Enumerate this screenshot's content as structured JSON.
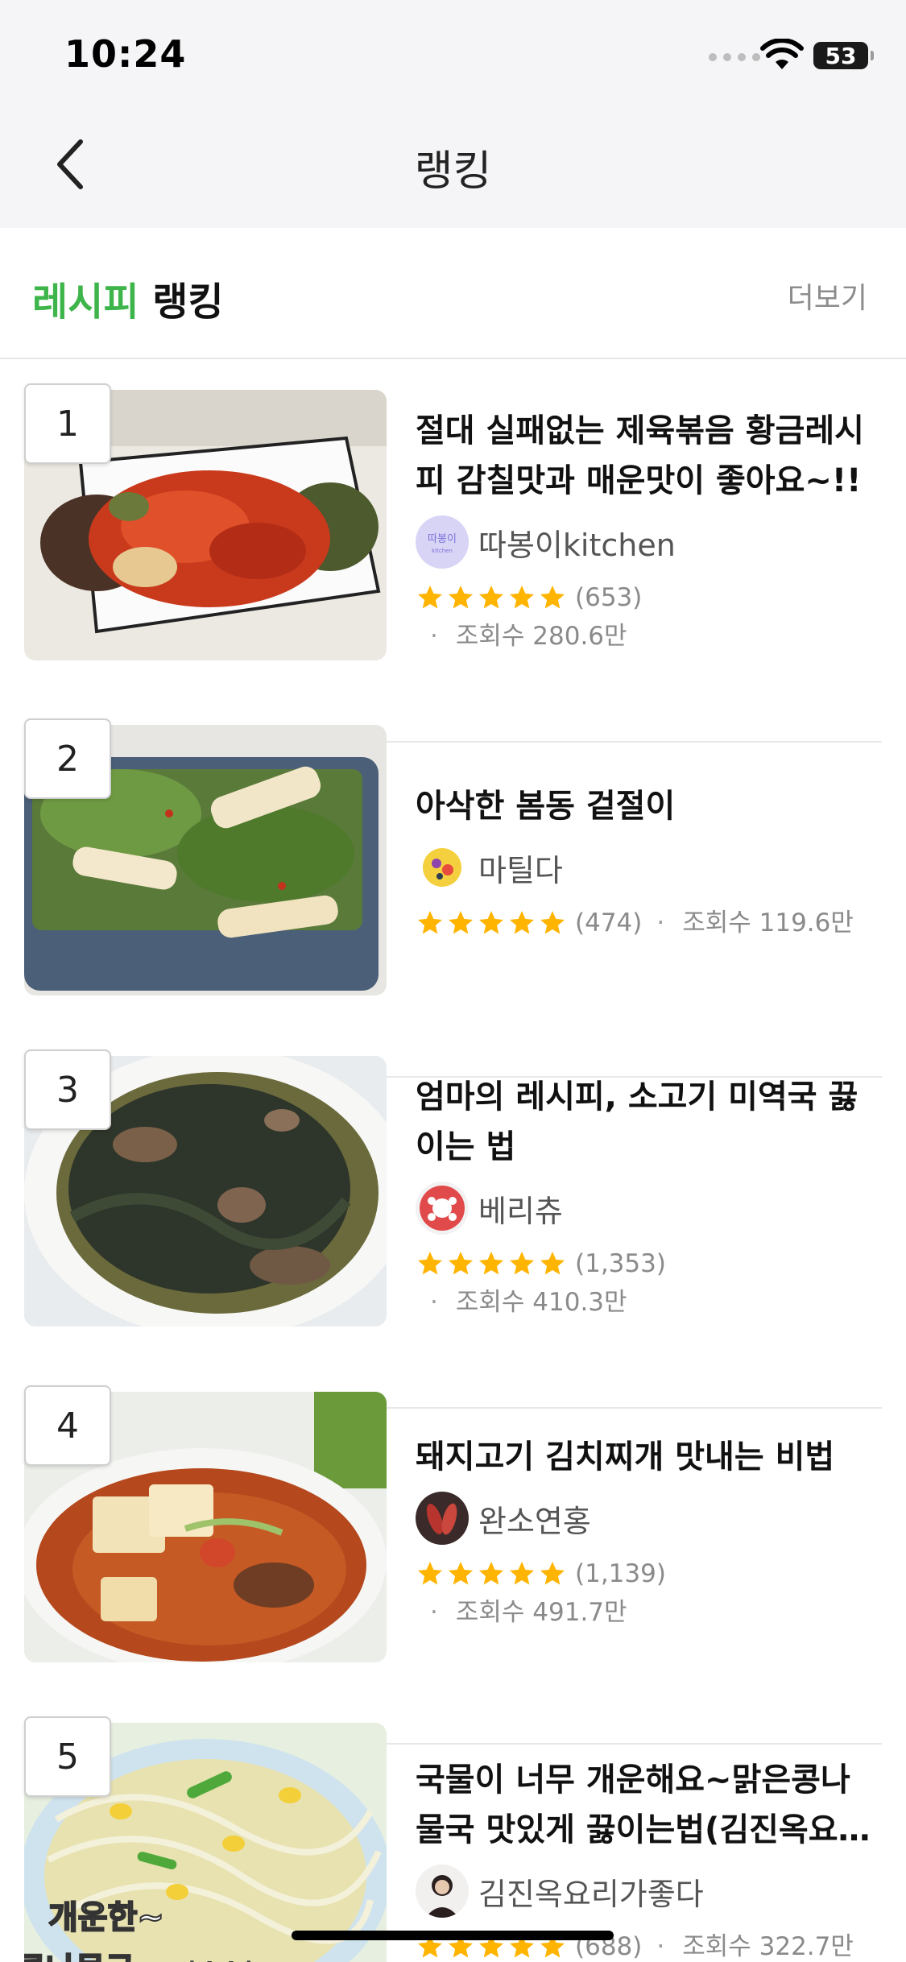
{
  "status_bar": {
    "time": "10:24",
    "battery": "53"
  },
  "nav": {
    "title": "랭킹"
  },
  "section": {
    "title_accent": "레시피",
    "title_rest": " 랭킹",
    "more_label": "더보기"
  },
  "colors": {
    "accent": "#3eb54a",
    "star": "#ffb400"
  },
  "recipes": [
    {
      "rank": "1",
      "title": "절대 실패없는 제육볶음 황금레시피 감칠맛과 매운맛이 좋아요~!!",
      "author": "따봉이kitchen",
      "rating_count": "(653)",
      "views": "조회수 280.6만",
      "stars": 5
    },
    {
      "rank": "2",
      "title": "아삭한 봄동 겉절이",
      "author": "마틸다",
      "rating_count": "(474)",
      "views": "조회수 119.6만",
      "stars": 5
    },
    {
      "rank": "3",
      "title": "엄마의 레시피, 소고기 미역국 끓이는 법",
      "author": "베리츄",
      "rating_count": "(1,353)",
      "views": "조회수 410.3만",
      "stars": 5
    },
    {
      "rank": "4",
      "title": "돼지고기 김치찌개 맛내는 비법",
      "author": "완소연홍",
      "rating_count": "(1,139)",
      "views": "조회수 491.7만",
      "stars": 5
    },
    {
      "rank": "5",
      "title": "국물이 너무 개운해요~맑은콩나물국 맛있게 끓이는법(김진옥요리가좋다)",
      "author": "김진옥요리가좋다",
      "rating_count": "(688)",
      "views": "조회수 322.7만",
      "stars": 5,
      "thumb_text": [
        "개운한~",
        "콩나물국",
        "*^^*"
      ]
    }
  ]
}
